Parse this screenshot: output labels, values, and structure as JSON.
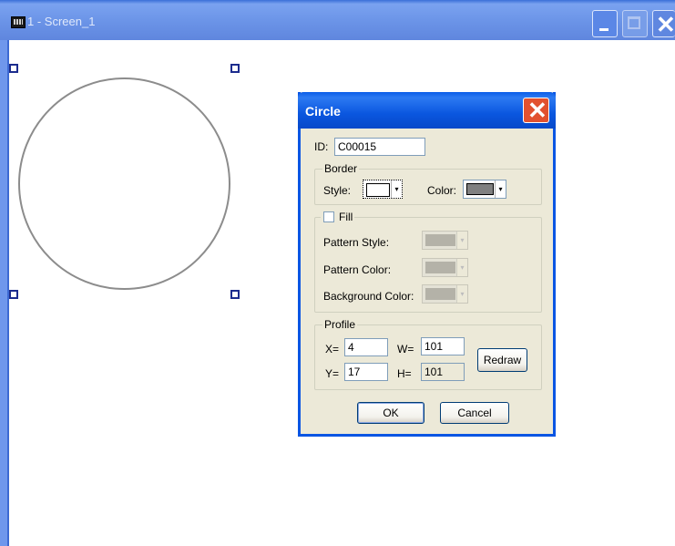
{
  "window": {
    "title": "1 - Screen_1",
    "icon": "screen-icon",
    "buttons": [
      "minimize",
      "maximize",
      "close"
    ]
  },
  "dialog": {
    "title": "Circle",
    "close_glyph": "✕",
    "id": {
      "label": "ID:",
      "value": "C00015"
    },
    "border": {
      "group_label": "Border",
      "style_label": "Style:",
      "color_label": "Color:",
      "color_value": "#808080",
      "dropdown_arrow": "▾"
    },
    "fill": {
      "group_label": "Fill",
      "checked": false,
      "pattern_style_label": "Pattern Style:",
      "pattern_color_label": "Pattern Color:",
      "background_color_label": "Background Color:"
    },
    "profile": {
      "group_label": "Profile",
      "x_label": "X=",
      "x_value": "4",
      "y_label": "Y=",
      "y_value": "17",
      "w_label": "W=",
      "w_value": "101",
      "h_label": "H=",
      "h_value": "101",
      "redraw_label": "Redraw"
    },
    "ok_label": "OK",
    "cancel_label": "Cancel"
  },
  "colors": {
    "title_bar": "#3a6fd8",
    "dialog_title": "#0a56df",
    "close_button": "#e2512f",
    "selection_handle": "#1c2c8e",
    "circle_stroke": "#8c8c8c"
  }
}
